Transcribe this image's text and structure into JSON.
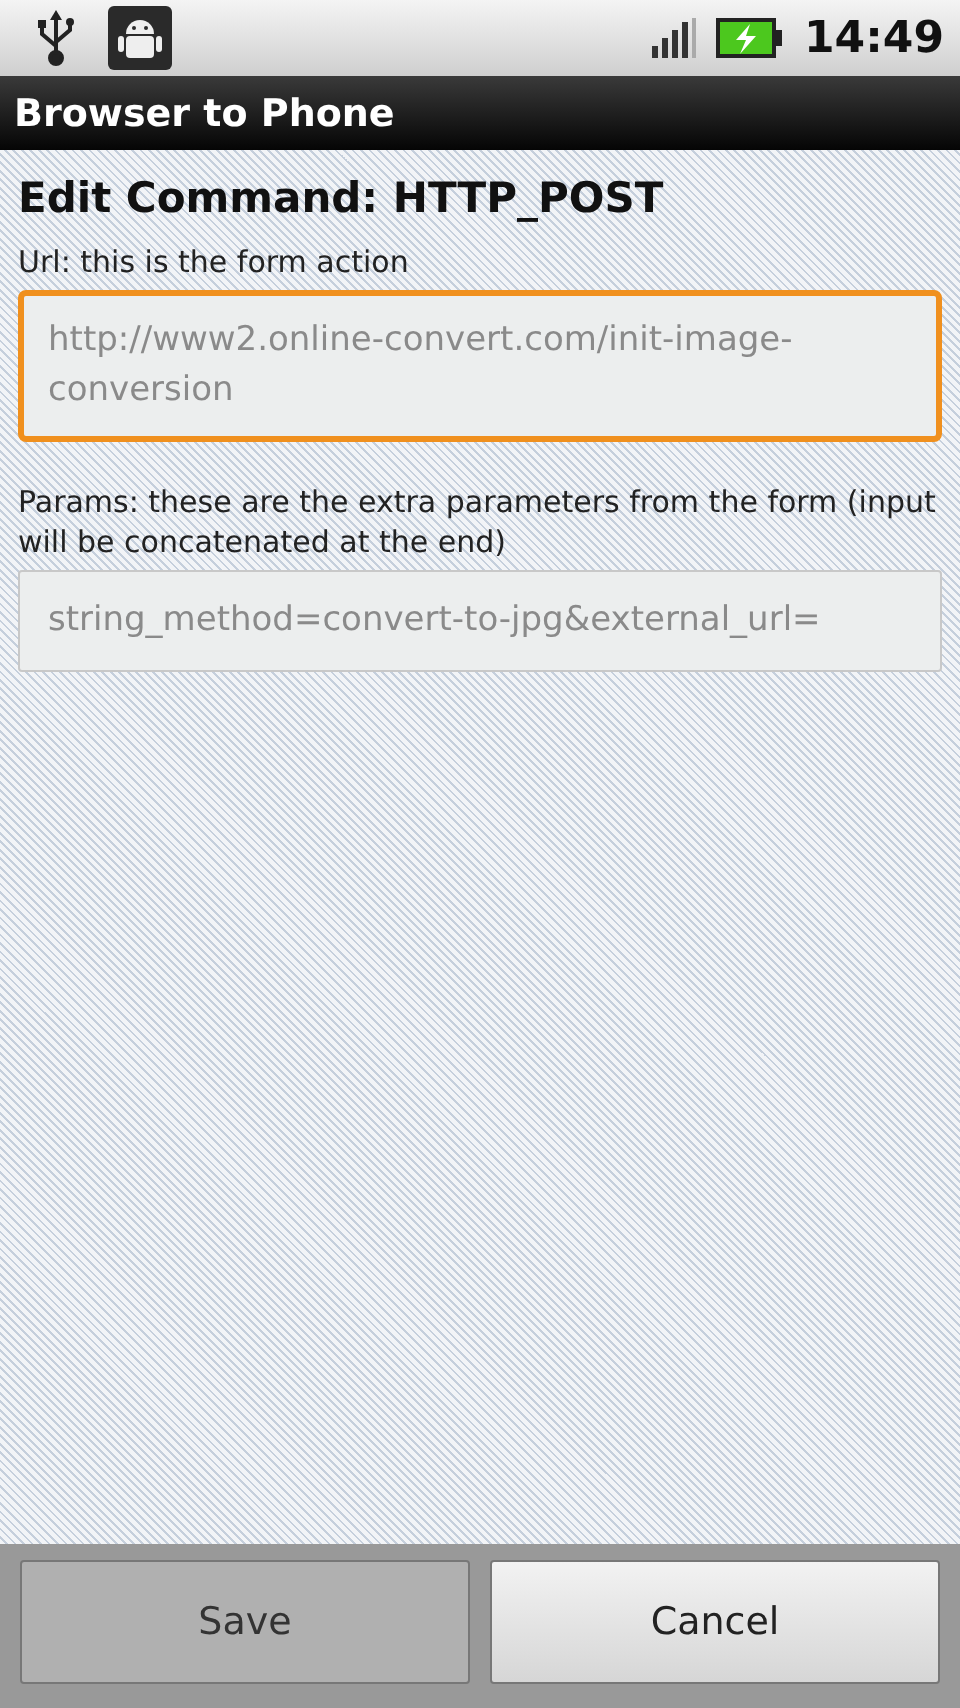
{
  "status_bar": {
    "time": "14:49"
  },
  "window": {
    "title": "Browser to Phone"
  },
  "heading": "Edit Command: HTTP_POST",
  "fields": [
    {
      "label": "Url: this is the form action",
      "placeholder": "http://www2.online-convert.com/init-image-conversion",
      "focused": true
    },
    {
      "label": "Params: these are the extra parameters from the form (input will be concatenated at the end)",
      "placeholder": "string_method=convert-to-jpg&external_url=",
      "focused": false
    }
  ],
  "buttons": [
    {
      "label": "Save",
      "disabled": true
    },
    {
      "label": "Cancel",
      "disabled": false
    }
  ]
}
